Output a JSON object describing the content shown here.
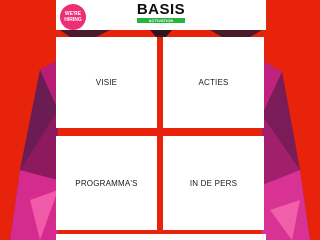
{
  "header": {
    "logo_text": "BASIS",
    "logo_subtext": "ACTIVATION MARKETING",
    "hiring_badge": {
      "line1": "WE'RE",
      "line2": "HIRING"
    }
  },
  "tiles": [
    {
      "label": "VISIE"
    },
    {
      "label": "ACTIES"
    },
    {
      "label": "PROGRAMMA'S"
    },
    {
      "label": "IN DE PERS"
    }
  ],
  "colors": {
    "background": "#e8230c",
    "badge": "#ee2e76",
    "logo_accent": "#25b53c",
    "tile": "#ffffff"
  }
}
